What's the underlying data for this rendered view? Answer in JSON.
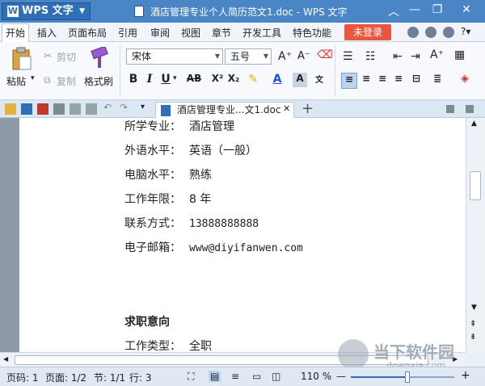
{
  "titlebar": {
    "app_label": "WPS 文字",
    "window_title": "酒店管理专业个人简历范文1.doc - WPS 文字"
  },
  "menu": {
    "items": [
      "开始",
      "插入",
      "页面布局",
      "引用",
      "审阅",
      "视图",
      "章节",
      "开发工具",
      "特色功能"
    ],
    "login": "未登录"
  },
  "ribbon": {
    "paste": "粘贴",
    "cut": "剪切",
    "copy": "复制",
    "format_painter": "格式刷",
    "font_name": "宋体",
    "font_size": "五号"
  },
  "tabs": {
    "doc_tab": "酒店管理专业...文1.doc"
  },
  "document": {
    "lines": [
      {
        "label": "所学专业：",
        "value": "酒店管理"
      },
      {
        "label": "外语水平：",
        "value": "英语（一般）"
      },
      {
        "label": "电脑水平：",
        "value": "熟练"
      },
      {
        "label": "工作年限：",
        "value": "8 年"
      },
      {
        "label": "联系方式：",
        "value": "13888888888"
      },
      {
        "label": "电子邮箱：",
        "value": "www@diyifanwen.com"
      }
    ],
    "section_heading": "求职意向",
    "job_type_label": "工作类型：",
    "job_type_value": "全职"
  },
  "status": {
    "page_no": "页码: 1",
    "page": "页面: 1/2",
    "section": "节: 1/1",
    "row": "行: 3",
    "zoom": "110 %",
    "zoom_level_percent": 55
  },
  "watermark": {
    "text": "当下软件园",
    "sub": "downxia.com"
  },
  "colors": {
    "title_bar": "#4a86c5",
    "login_button": "#e9573f",
    "accent": "#2f6fb6"
  }
}
